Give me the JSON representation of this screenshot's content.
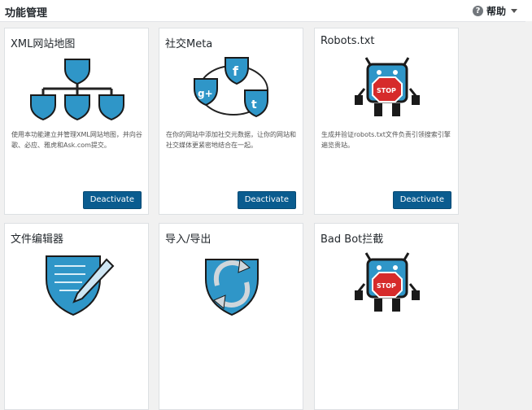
{
  "header": {
    "title": "功能管理",
    "help_label": "帮助",
    "help_icon": "question-icon"
  },
  "cards": [
    {
      "title": "XML网站地图",
      "desc": "使用本功能建立并管理XML网站地图，并向谷歌、必应、雅虎和Ask.com提交。",
      "button": "Deactivate",
      "icon": "sitemap-icon"
    },
    {
      "title": "社交Meta",
      "desc": "在你的网站中添加社交元数据，让你的网站和社交媒体更紧密地结合在一起。",
      "button": "Deactivate",
      "icon": "social-icon"
    },
    {
      "title": "Robots.txt",
      "desc": "生成并验证robots.txt文件负责引领搜索引擎遍览贵站。",
      "button": "Deactivate",
      "icon": "robot-icon"
    },
    {
      "title": "文件编辑器",
      "icon": "file-editor-icon"
    },
    {
      "title": "导入/导出",
      "icon": "import-export-icon"
    },
    {
      "title": "Bad Bot拦截",
      "icon": "bad-bot-icon"
    }
  ],
  "colors": {
    "accent": "#0a5c8f",
    "icon_blue": "#2f96c8"
  }
}
